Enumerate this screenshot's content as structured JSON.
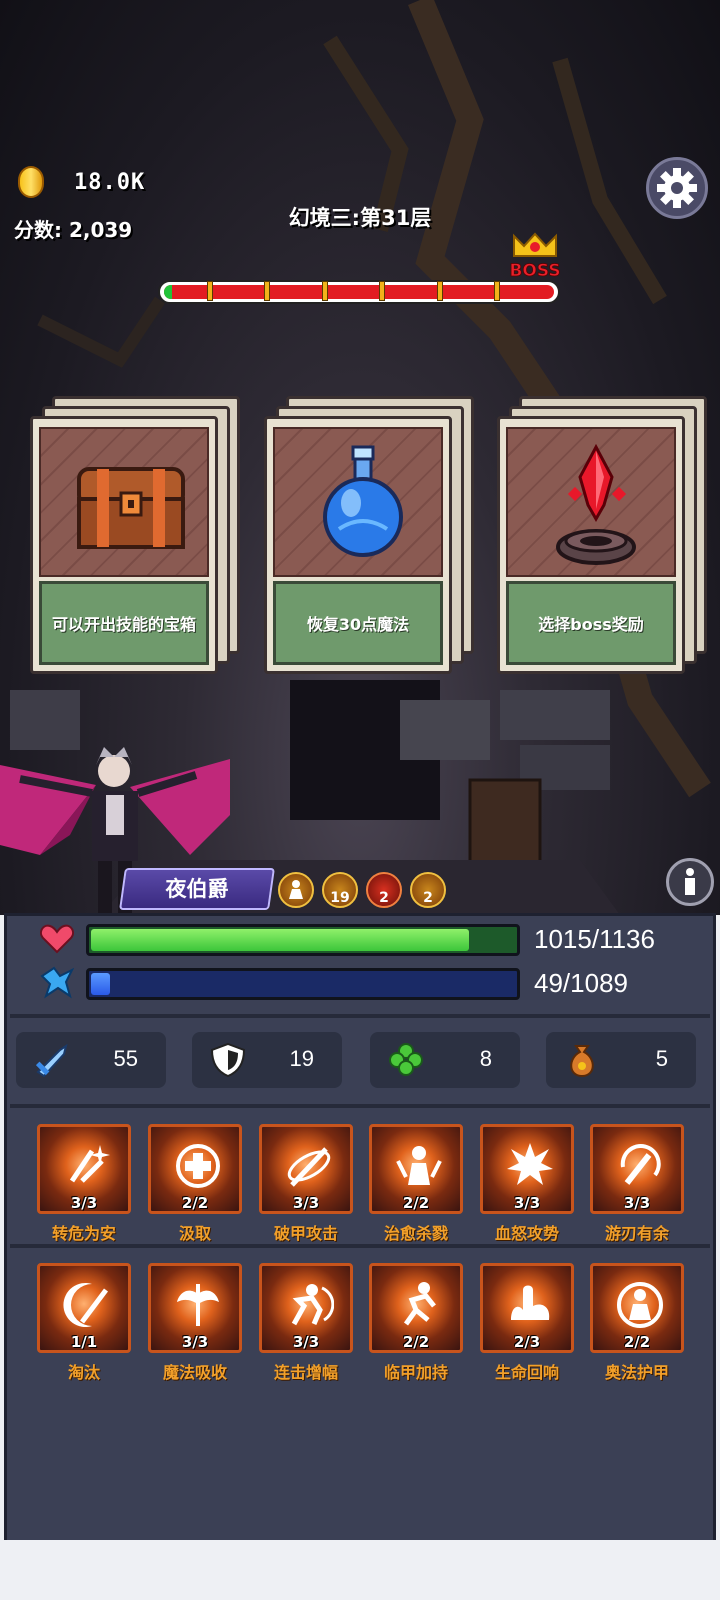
{
  "hud": {
    "coins": "18.0K",
    "score": "分数: 2,039",
    "stage": "幻境三:第31层",
    "boss_tag": "BOSS",
    "stage_progress": 0.02
  },
  "cards": [
    {
      "label": "可以开出技能的宝箱",
      "icon": "treasure-chest-icon"
    },
    {
      "label": "恢复30点魔法",
      "icon": "blue-potion-icon"
    },
    {
      "label": "选择boss奖励",
      "icon": "red-crystal-altar-icon"
    }
  ],
  "hero": {
    "name": "夜伯爵"
  },
  "buffs": [
    {
      "icon": "figure-buff-icon",
      "count": ""
    },
    {
      "icon": "shield-buff-icon",
      "count": "19"
    },
    {
      "icon": "blood-drop-buff-icon",
      "count": "2"
    },
    {
      "icon": "sword-buff-icon",
      "count": "2"
    }
  ],
  "stats": {
    "hp": {
      "text": "1015/1136",
      "fraction": 0.893
    },
    "mp": {
      "text": "49/1089",
      "fraction": 0.045
    }
  },
  "attributes": [
    {
      "icon": "sword-icon",
      "value": "55"
    },
    {
      "icon": "shield-icon",
      "value": "19"
    },
    {
      "icon": "clover-icon",
      "value": "8"
    },
    {
      "icon": "money-bag-icon",
      "value": "5"
    }
  ],
  "skills_row1": [
    {
      "name": "转危为安",
      "count": "3/3"
    },
    {
      "name": "汲取",
      "count": "2/2"
    },
    {
      "name": "破甲攻击",
      "count": "3/3"
    },
    {
      "name": "治愈杀戮",
      "count": "2/2"
    },
    {
      "name": "血怒攻势",
      "count": "3/3"
    },
    {
      "name": "游刃有余",
      "count": "3/3"
    }
  ],
  "skills_row2": [
    {
      "name": "淘汰",
      "count": "1/1"
    },
    {
      "name": "魔法吸收",
      "count": "3/3"
    },
    {
      "name": "连击增幅",
      "count": "3/3"
    },
    {
      "name": "临甲加持",
      "count": "2/2"
    },
    {
      "name": "生命回响",
      "count": "2/3"
    },
    {
      "name": "奥法护甲",
      "count": "2/2"
    }
  ],
  "colors": {
    "hp": "#3cc63a",
    "mp": "#2a5ae8",
    "skill_name": "#f2a02a",
    "panel": "#3b4055"
  }
}
